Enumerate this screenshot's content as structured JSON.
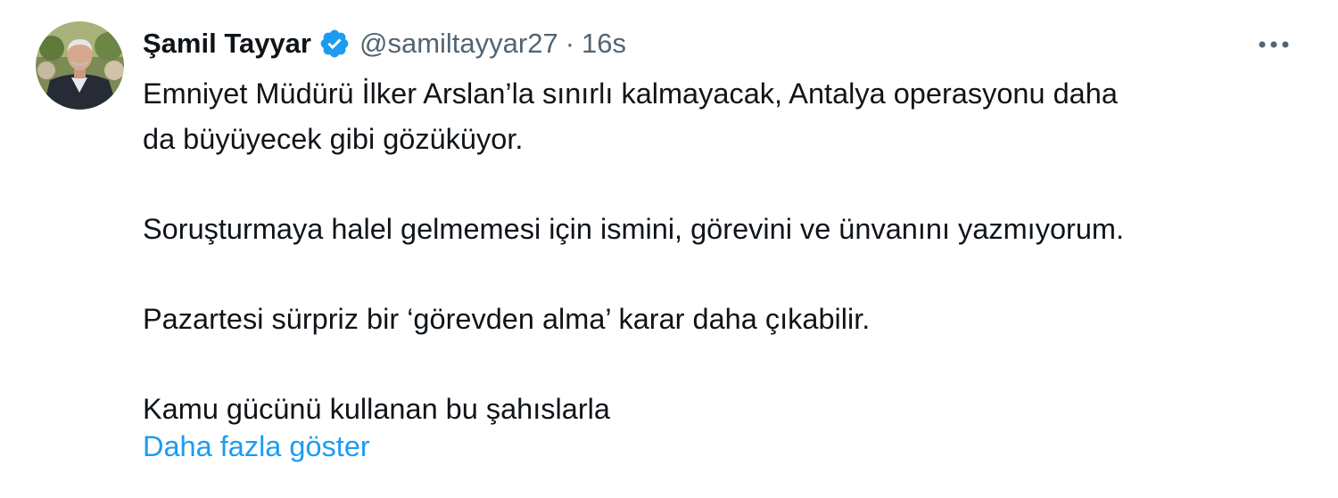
{
  "author": {
    "display_name": "Şamil Tayyar",
    "handle": "@samiltayyar27",
    "separator": "·",
    "timestamp": "16s",
    "verified": true,
    "verified_color": "#1d9bf0"
  },
  "tweet": {
    "line1": "Emniyet Müdürü İlker Arslan’la sınırlı kalmayacak, Antalya operasyonu daha",
    "line2": "da büyüyecek gibi gözüküyor.",
    "line3": "Soruşturmaya halel gelmemesi için ismini, görevini ve ünvanını yazmıyorum.",
    "line4": "Pazartesi sürpriz bir ‘görevden alma’ karar daha çıkabilir.",
    "line5": "Kamu gücünü kullanan bu şahıslarla",
    "show_more": "Daha fazla göster"
  },
  "icons": {
    "more": "more-horizontal-icon",
    "verified": "verified-badge-icon"
  },
  "colors": {
    "text": "#0f1419",
    "secondary": "#536471",
    "link": "#1d9bf0"
  }
}
